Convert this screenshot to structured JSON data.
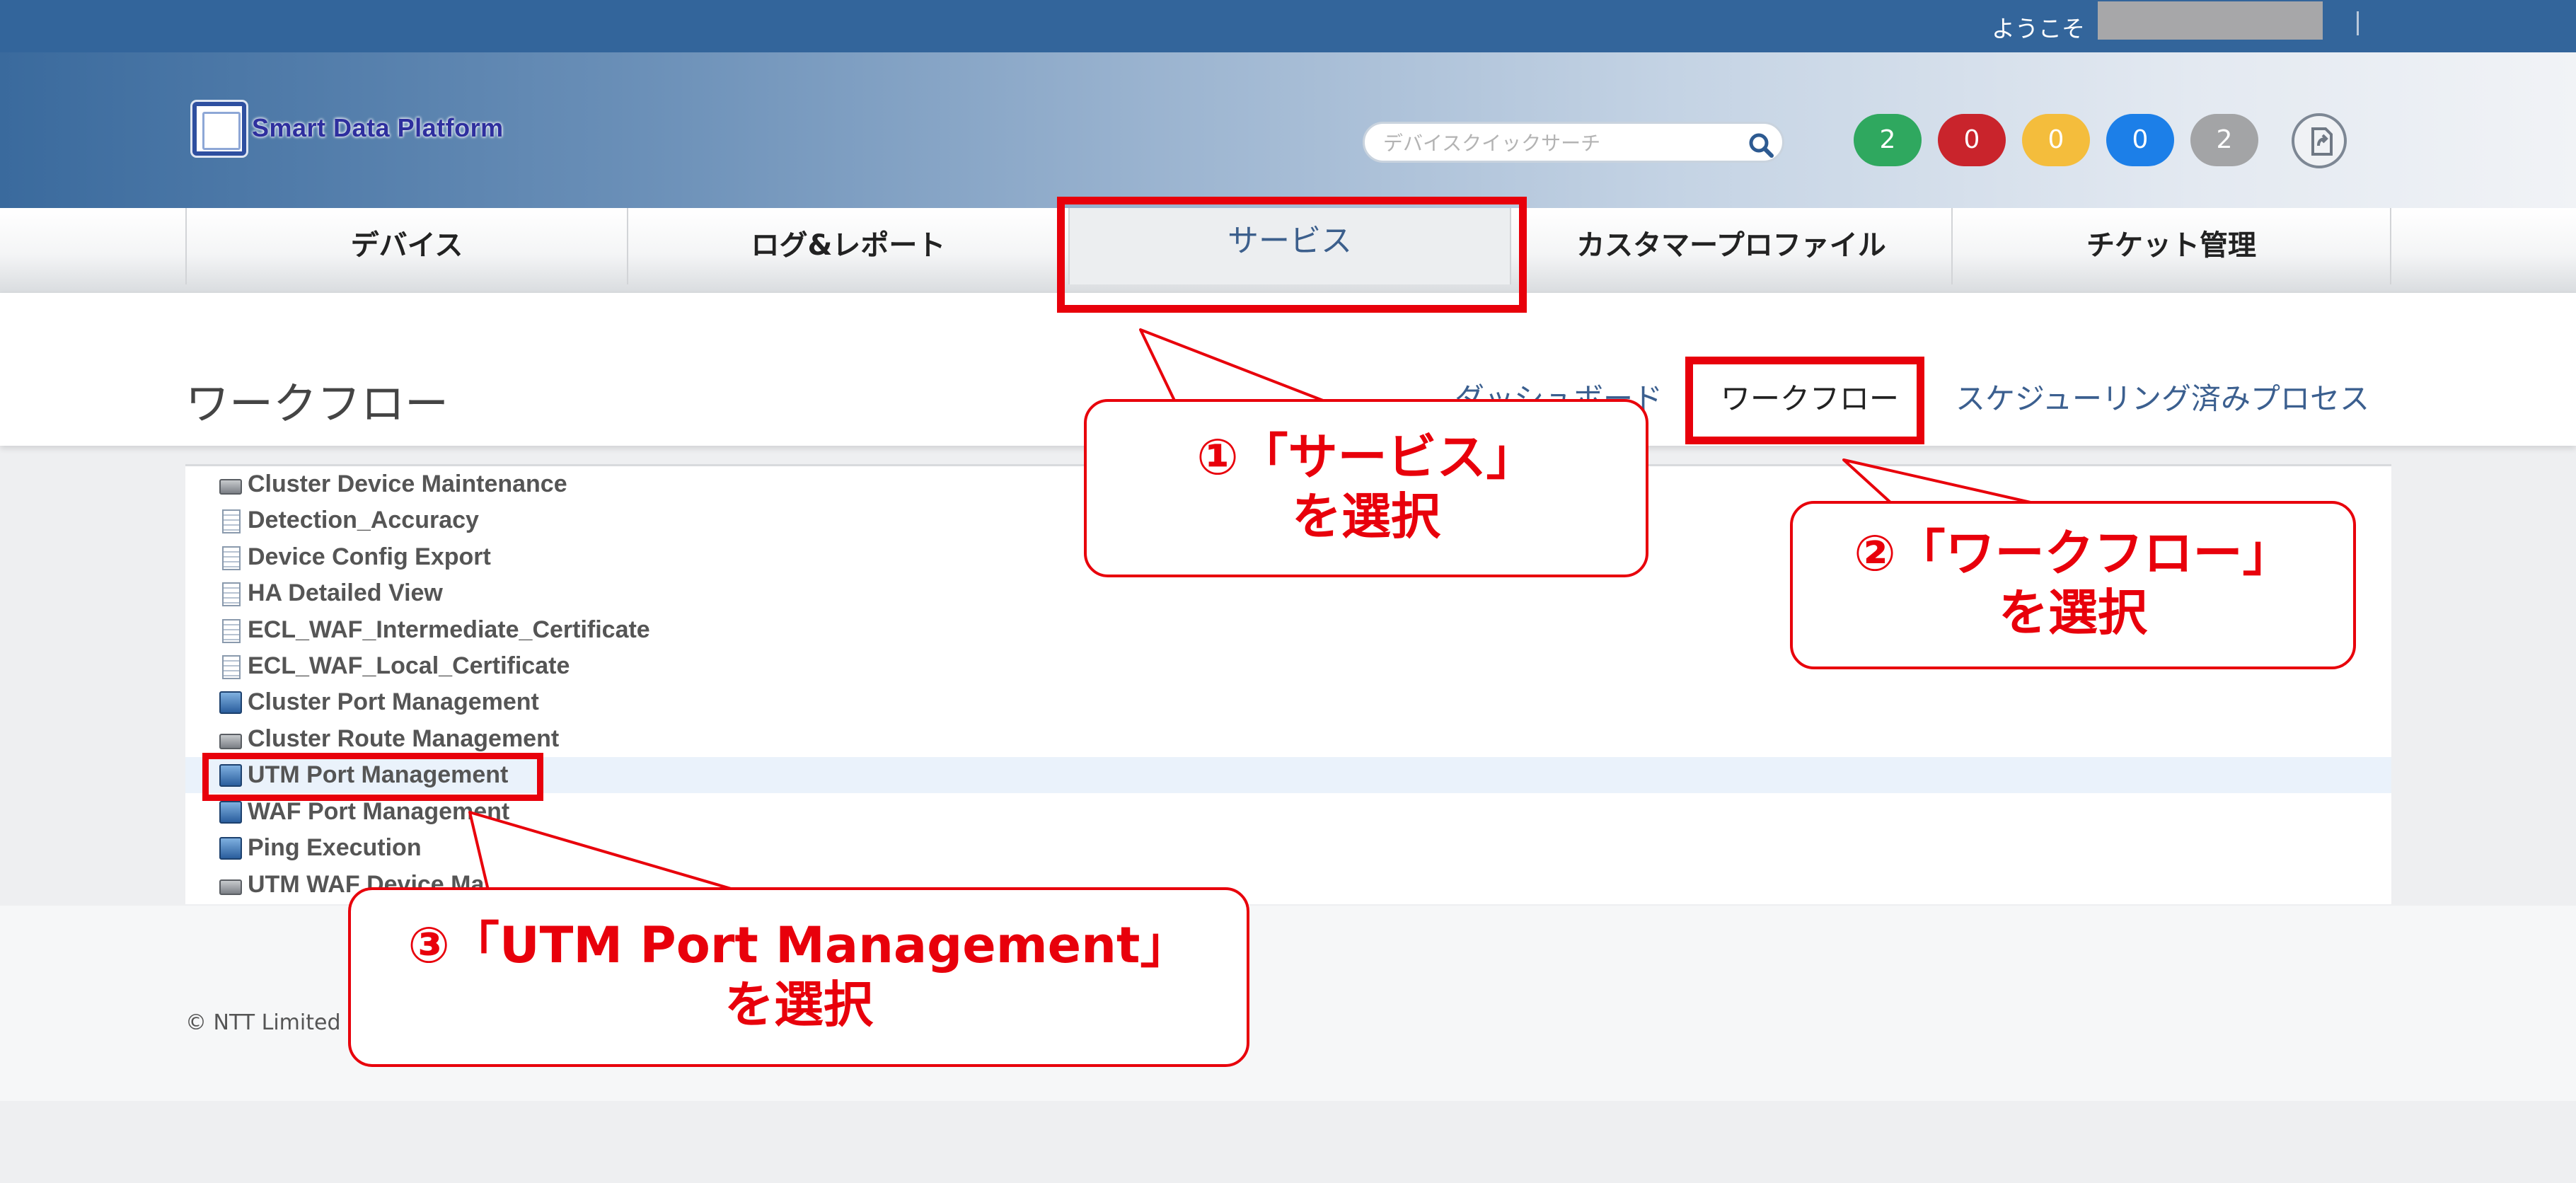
{
  "header": {
    "welcome": "ようこそ",
    "logo_text": "Smart Data Platform",
    "search_placeholder": "デバイスクイックサーチ",
    "badges": [
      {
        "value": "2",
        "color": "#2fa85f"
      },
      {
        "value": "0",
        "color": "#c9242c"
      },
      {
        "value": "0",
        "color": "#f4bd3c"
      },
      {
        "value": "0",
        "color": "#1c7fe8"
      },
      {
        "value": "2",
        "color": "#a3a4a6"
      }
    ]
  },
  "nav": {
    "items": [
      {
        "label": "デバイス"
      },
      {
        "label": "ログ&レポート"
      },
      {
        "label": "サービス",
        "active": true
      },
      {
        "label": "カスタマープロファイル"
      },
      {
        "label": "チケット管理"
      }
    ]
  },
  "subheader": {
    "title": "ワークフロー",
    "links": [
      {
        "label": "ダッシュボード"
      },
      {
        "label": "ワークフロー",
        "current": true
      },
      {
        "label": "スケジューリング済みプロセス"
      }
    ]
  },
  "workflows": [
    {
      "label": "Cluster Device Maintenance",
      "icon": "server-icon"
    },
    {
      "label": "Detection_Accuracy",
      "icon": "document-icon"
    },
    {
      "label": "Device Config Export",
      "icon": "document-icon"
    },
    {
      "label": "HA Detailed View",
      "icon": "document-icon"
    },
    {
      "label": "ECL_WAF_Intermediate_Certificate",
      "icon": "document-icon"
    },
    {
      "label": "ECL_WAF_Local_Certificate",
      "icon": "document-icon"
    },
    {
      "label": "Cluster Port Management",
      "icon": "network-icon"
    },
    {
      "label": "Cluster Route Management",
      "icon": "server-icon"
    },
    {
      "label": "UTM Port Management",
      "icon": "network-icon",
      "selected": true
    },
    {
      "label": "WAF Port Management",
      "icon": "network-icon"
    },
    {
      "label": "Ping Execution",
      "icon": "network-icon"
    },
    {
      "label": "UTM WAF Device Maintenance",
      "icon": "server-icon"
    }
  ],
  "footer": {
    "copyright": "© NTT Limited a"
  },
  "annotations": {
    "step1": {
      "line1": "①「サービス」",
      "line2": "を選択"
    },
    "step2": {
      "line1": "②「ワークフロー」",
      "line2": "を選択"
    },
    "step3": {
      "line1": "③「UTM Port Management」",
      "line2": "を選択"
    },
    "highlight_color": "#e8000b"
  }
}
